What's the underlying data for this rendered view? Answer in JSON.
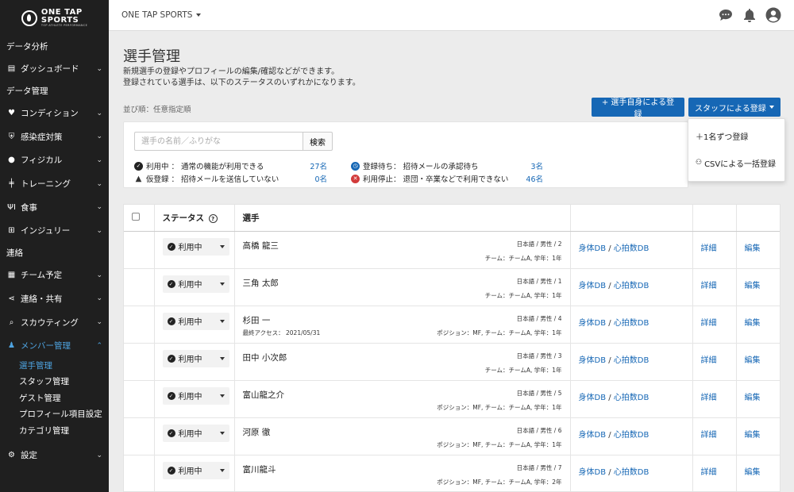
{
  "sidebar": {
    "logo": {
      "line1": "ONE TAP",
      "line2": "SPORTS",
      "tagline": "TOP ATHLETE PERFORMANCE"
    },
    "sections": {
      "analysis": "データ分析",
      "management": "データ管理",
      "contact": "連絡"
    },
    "items": {
      "dashboard": "ダッシュボード",
      "condition": "コンディション",
      "infection": "感染症対策",
      "physical": "フィジカル",
      "training": "トレーニング",
      "meal": "食事",
      "injury": "インジュリー",
      "schedule": "チーム予定",
      "share": "連絡・共有",
      "scouting": "スカウティング",
      "member": "メンバー管理",
      "settings": "設定"
    },
    "subitems": {
      "players": "選手管理",
      "staff": "スタッフ管理",
      "guest": "ゲスト管理",
      "profile_fields": "プロフィール項目設定",
      "category": "カテゴリ管理"
    }
  },
  "header": {
    "team": "ONE TAP SPORTS",
    "icons": [
      "chat-icon",
      "bell-icon",
      "user-avatar-icon"
    ]
  },
  "main": {
    "title": "選手管理",
    "desc1": "新規選手の登録やプロフィールの編集/確認などができます。",
    "desc2": "登録されている選手は、以下のステータスのいずれかになります。",
    "sort_label": "並び順：任意指定順",
    "btn_self": "+ 選手自身による登録",
    "btn_staff": "スタッフによる登録",
    "dropdown": {
      "single": "＋1名ずつ登録",
      "csv": "CSVによる一括登録"
    },
    "search": {
      "placeholder": "選手の名前／ふりがな",
      "button": "検索"
    },
    "legend": {
      "active": {
        "label": "利用中 ： 通常の機能が利用できる",
        "count": "27名"
      },
      "temp": {
        "label": "仮登録 ： 招待メールを送信していない",
        "count": "0名"
      },
      "pending": {
        "label": "登録待ち： 招待メールの承認待ち",
        "count": "3名"
      },
      "stopped": {
        "label": "利用停止： 退団・卒業などで利用できない",
        "count": "46名"
      }
    }
  },
  "table": {
    "headers": {
      "status": "ステータス",
      "player": "選手"
    },
    "rows": [
      {
        "status": "利用中",
        "name": "高橋 龍三",
        "meta1": "日本語 / 男性 / 2",
        "meta2": "チーム：チームA, 学年：1年",
        "access": "",
        "db1": "身体DB",
        "sep": " / ",
        "db2": "心拍数DB",
        "detail": "詳細",
        "edit": "編集"
      },
      {
        "status": "利用中",
        "name": "三角 太郎",
        "meta1": "日本語 / 男性 / 1",
        "meta2": "チーム：チームA, 学年：1年",
        "access": "",
        "db1": "身体DB",
        "sep": " / ",
        "db2": "心拍数DB",
        "detail": "詳細",
        "edit": "編集"
      },
      {
        "status": "利用中",
        "name": "杉田 一",
        "meta1": "日本語 / 男性 / 4",
        "meta2": "ポジション：MF, チーム：チームA, 学年：1年",
        "access": "最終アクセス： 2021/05/31",
        "db1": "身体DB",
        "sep": " / ",
        "db2": "心拍数DB",
        "detail": "詳細",
        "edit": "編集"
      },
      {
        "status": "利用中",
        "name": "田中 小次郎",
        "meta1": "日本語 / 男性 / 3",
        "meta2": "チーム：チームA, 学年：1年",
        "access": "",
        "db1": "身体DB",
        "sep": " / ",
        "db2": "心拍数DB",
        "detail": "詳細",
        "edit": "編集"
      },
      {
        "status": "利用中",
        "name": "富山龍之介",
        "meta1": "日本語 / 男性 / 5",
        "meta2": "ポジション：MF, チーム：チームA, 学年：1年",
        "access": "",
        "db1": "身体DB",
        "sep": " / ",
        "db2": "心拍数DB",
        "detail": "詳細",
        "edit": "編集"
      },
      {
        "status": "利用中",
        "name": "河原 徹",
        "meta1": "日本語 / 男性 / 6",
        "meta2": "ポジション：MF, チーム：チームA, 学年：1年",
        "access": "",
        "db1": "身体DB",
        "sep": " / ",
        "db2": "心拍数DB",
        "detail": "詳細",
        "edit": "編集"
      },
      {
        "status": "利用中",
        "name": "富川龍斗",
        "meta1": "日本語 / 男性 / 7",
        "meta2": "ポジション：MF, チーム：チームA, 学年：2年",
        "access": "",
        "db1": "身体DB",
        "sep": " / ",
        "db2": "心拍数DB",
        "detail": "詳細",
        "edit": "編集"
      }
    ]
  }
}
